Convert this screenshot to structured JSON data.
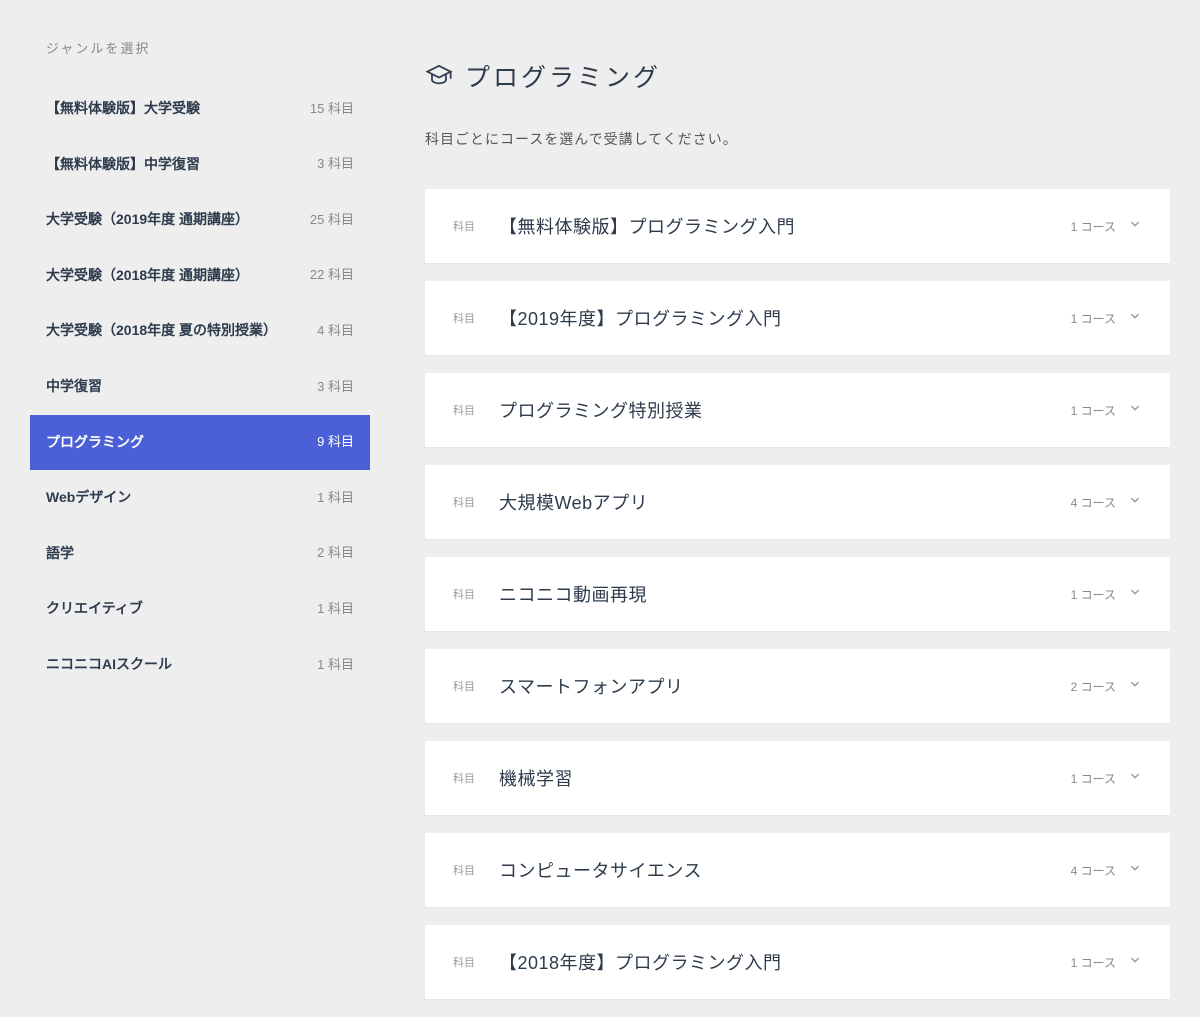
{
  "sidebar": {
    "title": "ジャンルを選択",
    "count_suffix": "科目",
    "items": [
      {
        "label": "【無料体験版】大学受験",
        "count": 15,
        "active": false
      },
      {
        "label": "【無料体験版】中学復習",
        "count": 3,
        "active": false
      },
      {
        "label": "大学受験（2019年度 通期講座）",
        "count": 25,
        "active": false
      },
      {
        "label": "大学受験（2018年度 通期講座）",
        "count": 22,
        "active": false
      },
      {
        "label": "大学受験（2018年度 夏の特別授業）",
        "count": 4,
        "active": false
      },
      {
        "label": "中学復習",
        "count": 3,
        "active": false
      },
      {
        "label": "プログラミング",
        "count": 9,
        "active": true
      },
      {
        "label": "Webデザイン",
        "count": 1,
        "active": false
      },
      {
        "label": "語学",
        "count": 2,
        "active": false
      },
      {
        "label": "クリエイティブ",
        "count": 1,
        "active": false
      },
      {
        "label": "ニコニコAIスクール",
        "count": 1,
        "active": false
      }
    ]
  },
  "main": {
    "title": "プログラミング",
    "subtitle": "科目ごとにコースを選んで受講してください。",
    "subject_badge": "科目",
    "course_suffix": "コース",
    "subjects": [
      {
        "title": "【無料体験版】プログラミング入門",
        "courses": 1
      },
      {
        "title": "【2019年度】プログラミング入門",
        "courses": 1
      },
      {
        "title": "プログラミング特別授業",
        "courses": 1
      },
      {
        "title": "大規模Webアプリ",
        "courses": 4
      },
      {
        "title": "ニコニコ動画再現",
        "courses": 1
      },
      {
        "title": "スマートフォンアプリ",
        "courses": 2
      },
      {
        "title": "機械学習",
        "courses": 1
      },
      {
        "title": "コンピュータサイエンス",
        "courses": 4
      },
      {
        "title": "【2018年度】プログラミング入門",
        "courses": 1
      }
    ]
  }
}
